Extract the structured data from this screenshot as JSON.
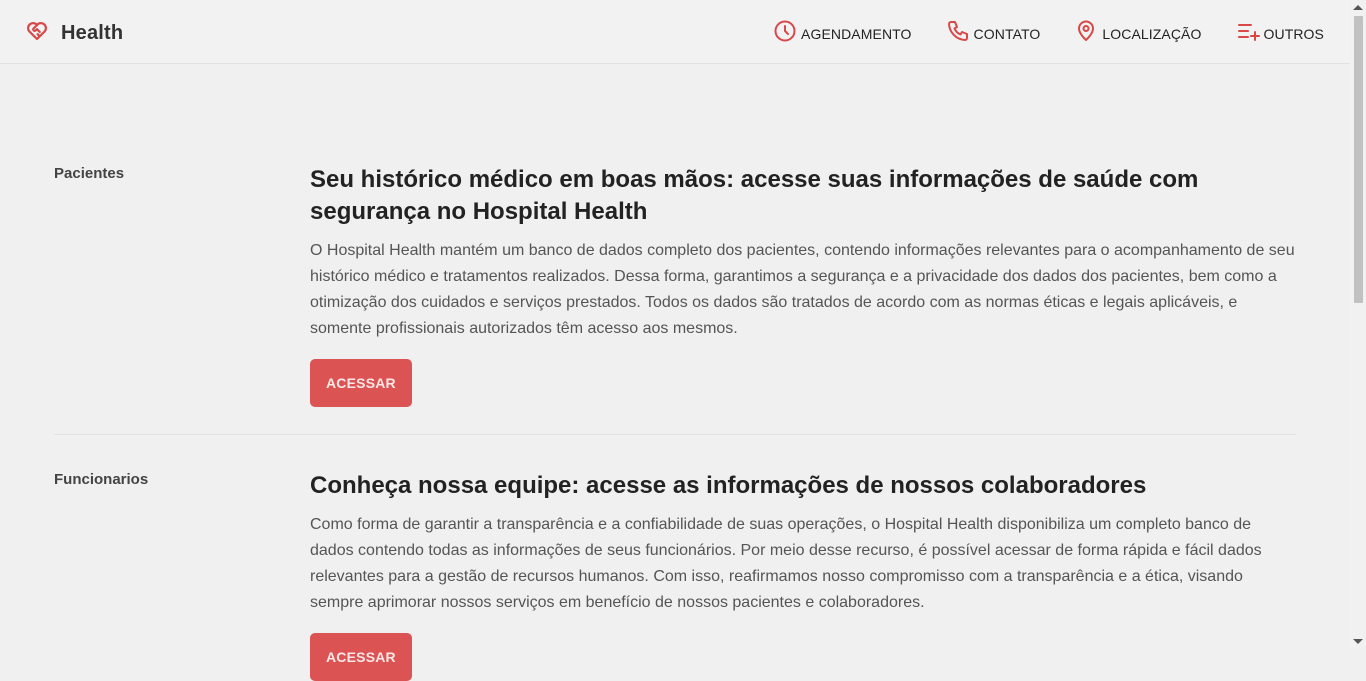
{
  "brand": {
    "name": "Health",
    "icon": "heart-handshake-icon",
    "accent_color": "#d94848"
  },
  "nav": [
    {
      "label": "AGENDAMENTO",
      "icon": "clock-icon"
    },
    {
      "label": "CONTATO",
      "icon": "phone-icon"
    },
    {
      "label": "LOCALIZAÇÃO",
      "icon": "map-pin-icon"
    },
    {
      "label": "OUTROS",
      "icon": "list-plus-icon"
    }
  ],
  "sections": [
    {
      "label": "Pacientes",
      "title": "Seu histórico médico em boas mãos: acesse suas informações de saúde com segurança no Hospital Health",
      "text": "O Hospital Health mantém um banco de dados completo dos pacientes, contendo informações relevantes para o acompanhamento de seu histórico médico e tratamentos realizados. Dessa forma, garantimos a segurança e a privacidade dos dados dos pacientes, bem como a otimização dos cuidados e serviços prestados. Todos os dados são tratados de acordo com as normas éticas e legais aplicáveis, e somente profissionais autorizados têm acesso aos mesmos.",
      "button": "ACESSAR"
    },
    {
      "label": "Funcionarios",
      "title": "Conheça nossa equipe: acesse as informações de nossos colaboradores",
      "text": "Como forma de garantir a transparência e a confiabilidade de suas operações, o Hospital Health disponibiliza um completo banco de dados contendo todas as informações de seus funcionários. Por meio desse recurso, é possível acessar de forma rápida e fácil dados relevantes para a gestão de recursos humanos. Com isso, reafirmamos nosso compromisso com a transparência e a ética, visando sempre aprimorar nossos serviços em benefício de nossos pacientes e colaboradores.",
      "button": "ACESSAR"
    }
  ],
  "colors": {
    "button_bg": "#dc5353",
    "page_bg": "#f0f0f0"
  }
}
